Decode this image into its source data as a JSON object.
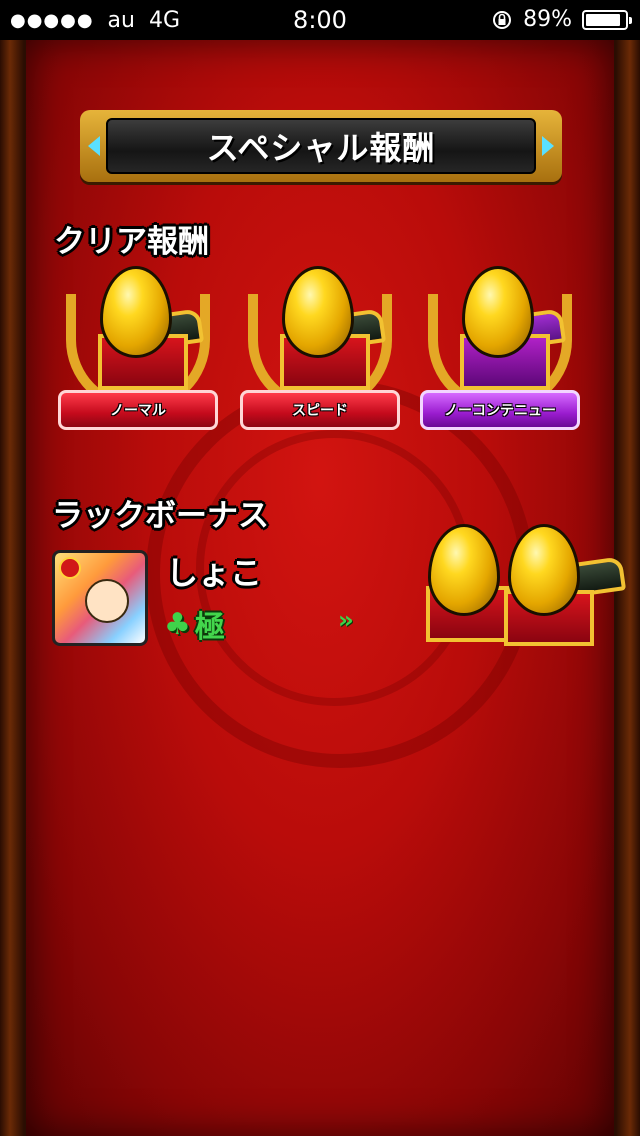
{
  "status_bar": {
    "signal": "●●●●●",
    "carrier": "au",
    "network": "4G",
    "time": "8:00",
    "battery": "89%",
    "battery_level": 0.89
  },
  "header": {
    "title": "スペシャル報酬"
  },
  "clear_rewards": {
    "heading": "クリア報酬",
    "items": [
      {
        "label": "ノーマル",
        "ribbon_color": "#c40a1c"
      },
      {
        "label": "スピード",
        "ribbon_color": "#c40a1c"
      },
      {
        "label": "ノーコンテニュー",
        "ribbon_color": "#9a1ccf"
      }
    ]
  },
  "luck_bonus": {
    "heading": "ラックボーナス",
    "character_name": "しょこ",
    "luck_icon": "clover-icon",
    "luck_value": "極",
    "arrows": "››"
  },
  "colors": {
    "accent_gold": "#e4a826",
    "background_red": "#b90c0a",
    "luck_green": "#43d64c"
  }
}
